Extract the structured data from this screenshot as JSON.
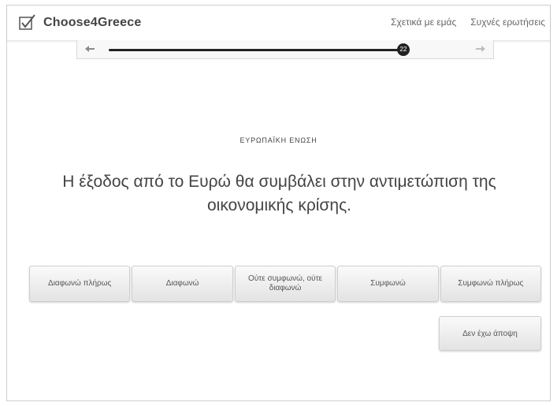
{
  "app": {
    "logo_text": "Choose4Greece",
    "logo_icon": "checkbox-check-icon"
  },
  "nav": {
    "about": "Σχετικά με εμάς",
    "faq": "Συχνές ερωτήσεις"
  },
  "progress": {
    "current_question": "22",
    "progress_fraction": 0.85,
    "back_icon": "back-arrow-icon",
    "forward_icon": "forward-arrow-icon"
  },
  "question": {
    "category": "ΕΥΡΩΠΑΪΚΗ ΕΝΩΣΗ",
    "text": "Η έξοδος από το Ευρώ θα συμβάλει στην αντιμετώπιση της οικονομικής κρίσης."
  },
  "answers": [
    {
      "label": "Διαφωνώ πλήρως"
    },
    {
      "label": "Διαφωνώ"
    },
    {
      "label": "Ούτε συμφωνώ, ούτε διαφωνώ"
    },
    {
      "label": "Συμφωνώ"
    },
    {
      "label": "Συμφωνώ πλήρως"
    }
  ],
  "no_opinion_label": "Δεν έχω άποψη"
}
